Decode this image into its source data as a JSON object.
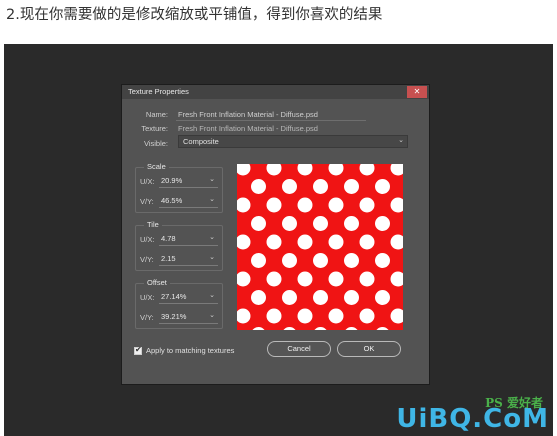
{
  "caption": "2.现在你需要做的是修改缩放或平铺值，得到你喜欢的结果",
  "dialog": {
    "title": "Texture Properties",
    "close_symbol": "✕",
    "name_label": "Name:",
    "name_value": "Fresh Front Inflation Material - Diffuse.psd",
    "texture_label": "Texture:",
    "texture_value": "Fresh Front Inflation Material - Diffuse.psd",
    "visible_label": "Visible:",
    "visible_value": "Composite",
    "scale": {
      "title": "Scale",
      "ux_label": "U/X:",
      "ux_value": "20.9%",
      "vy_label": "V/Y:",
      "vy_value": "46.5%"
    },
    "tile": {
      "title": "Tile",
      "ux_label": "U/X:",
      "ux_value": "4.78",
      "vy_label": "V/Y:",
      "vy_value": "2.15"
    },
    "offset": {
      "title": "Offset",
      "ux_label": "U/X:",
      "ux_value": "27.14%",
      "vy_label": "V/Y:",
      "vy_value": "39.21%"
    },
    "apply_label": "Apply to matching textures",
    "apply_checked": true,
    "cancel_label": "Cancel",
    "ok_label": "OK",
    "preview_colors": {
      "background": "#f01414",
      "dots": "#ffffff"
    }
  },
  "icons": {
    "dropdown": "chevron-down-icon",
    "close": "close-icon",
    "check": "checkmark-icon"
  },
  "watermark": {
    "brand": "UiBQ.CoM",
    "chinese": "PS 爱好者"
  }
}
